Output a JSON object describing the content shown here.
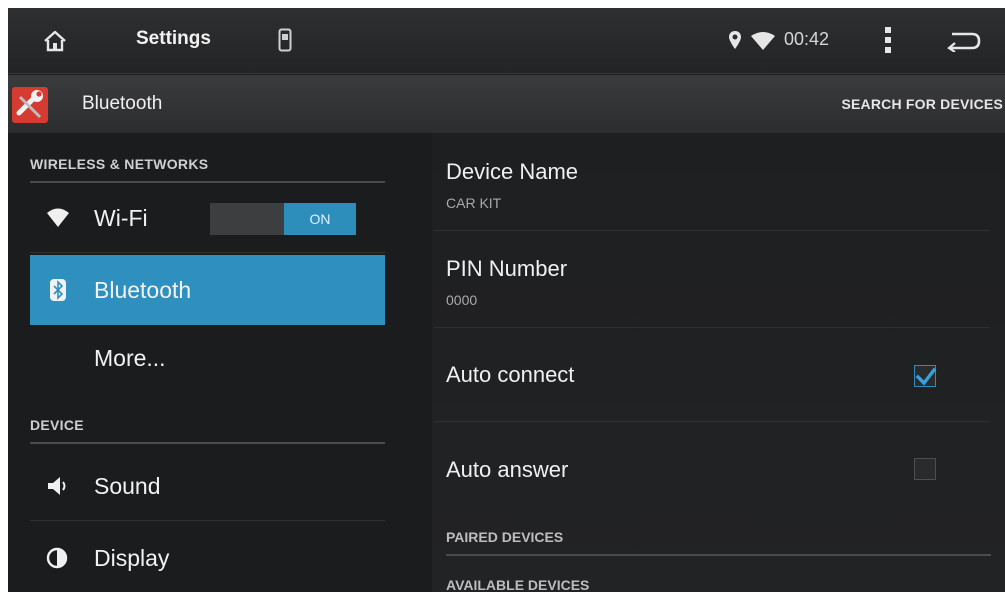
{
  "statusbar": {
    "title": "Settings",
    "time": "00:42"
  },
  "actionbar": {
    "title": "Bluetooth",
    "search_label": "SEARCH FOR DEVICES"
  },
  "left": {
    "wireless_header": "WIRELESS & NETWORKS",
    "wifi_label": "Wi-Fi",
    "wifi_toggle": "ON",
    "bluetooth_label": "Bluetooth",
    "more_label": "More...",
    "device_header": "DEVICE",
    "sound_label": "Sound",
    "display_label": "Display"
  },
  "right": {
    "device_name_title": "Device Name",
    "device_name_value": "CAR KIT",
    "pin_title": "PIN Number",
    "pin_value": "0000",
    "auto_connect_label": "Auto connect",
    "auto_connect_checked": true,
    "auto_answer_label": "Auto answer",
    "auto_answer_checked": false,
    "paired_header": "PAIRED DEVICES",
    "available_header": "AVAILABLE DEVICES"
  },
  "colors": {
    "accent": "#2f90bf",
    "background": "#1b1c1e"
  }
}
